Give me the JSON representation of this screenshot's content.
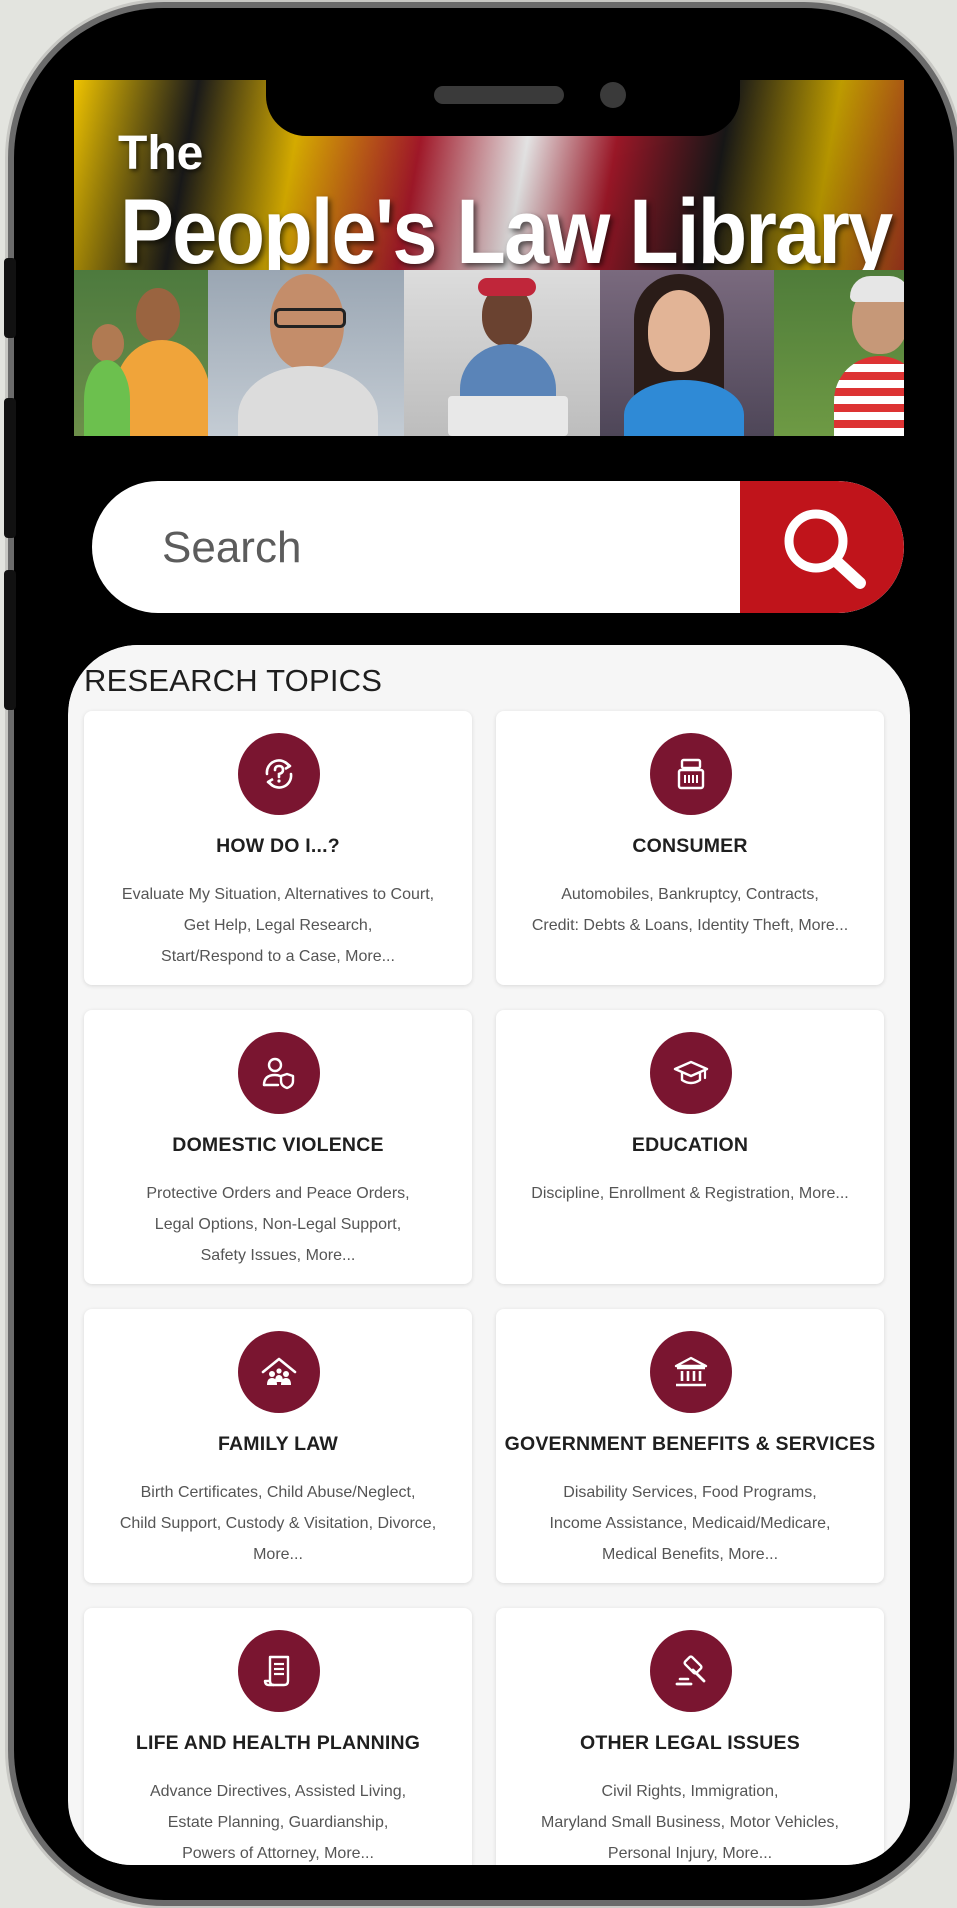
{
  "banner": {
    "line1": "The",
    "line2": "People's Law Library"
  },
  "search": {
    "placeholder": "Search"
  },
  "section": {
    "title": "RESEARCH TOPICS"
  },
  "topics": [
    {
      "title": "HOW DO I...?",
      "lines": [
        "Evaluate My Situation, Alternatives to Court,",
        "Get Help, Legal Research,",
        "Start/Respond to a Case, More..."
      ],
      "icon": "question-refresh-icon"
    },
    {
      "title": "CONSUMER",
      "lines": [
        "Automobiles, Bankruptcy, Contracts,",
        "Credit: Debts & Loans, Identity Theft, More..."
      ],
      "icon": "cash-register-icon"
    },
    {
      "title": "DOMESTIC VIOLENCE",
      "lines": [
        "Protective Orders and Peace Orders,",
        "Legal Options, Non-Legal Support,",
        "Safety Issues, More..."
      ],
      "icon": "person-shield-icon"
    },
    {
      "title": "EDUCATION",
      "lines": [
        "Discipline, Enrollment & Registration, More..."
      ],
      "icon": "graduation-cap-icon"
    },
    {
      "title": "FAMILY LAW",
      "lines": [
        "Birth Certificates, Child Abuse/Neglect,",
        "Child Support, Custody & Visitation, Divorce,",
        "More..."
      ],
      "icon": "family-house-icon"
    },
    {
      "title": "GOVERNMENT BENEFITS & SERVICES",
      "lines": [
        "Disability Services, Food Programs,",
        "Income Assistance, Medicaid/Medicare,",
        "Medical Benefits, More..."
      ],
      "icon": "government-building-icon"
    },
    {
      "title": "LIFE AND HEALTH PLANNING",
      "lines": [
        "Advance Directives, Assisted Living,",
        "Estate Planning, Guardianship,",
        "Powers of Attorney, More..."
      ],
      "icon": "document-scroll-icon"
    },
    {
      "title": "OTHER LEGAL ISSUES",
      "lines": [
        "Civil Rights, Immigration,",
        "Maryland Small Business, Motor Vehicles,",
        "Personal Injury, More..."
      ],
      "icon": "gavel-icon"
    }
  ],
  "colors": {
    "accent": "#7a1530",
    "search_button": "#c0141b"
  }
}
